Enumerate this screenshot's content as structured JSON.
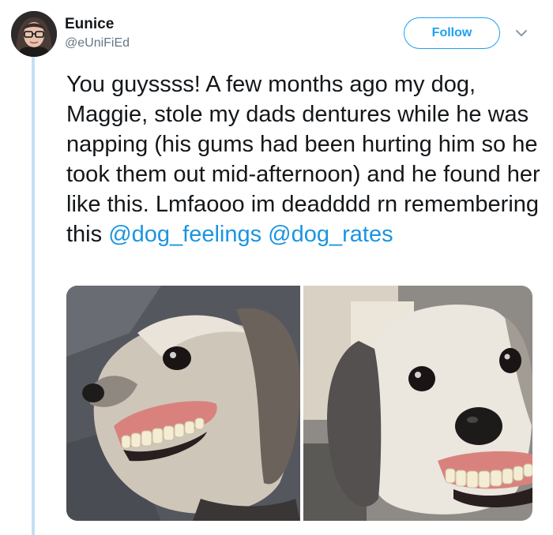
{
  "user": {
    "name": "Eunice",
    "handle": "@eUniFiEd"
  },
  "follow_label": "Follow",
  "tweet": {
    "text": "You guyssss! A few months ago my dog, Maggie, stole my dads dentures while he was napping (his gums had been hurting him so he took them out mid-afternoon) and he found her like this. Lmfaooo im deadddd rn remembering this ",
    "mentions": [
      "@dog_feelings",
      "@dog_rates"
    ]
  },
  "icons": {
    "more": "chevron-down-icon"
  },
  "colors": {
    "accent": "#1da1f2",
    "mention": "#1b95e0",
    "thread_line": "#c4dff5"
  }
}
